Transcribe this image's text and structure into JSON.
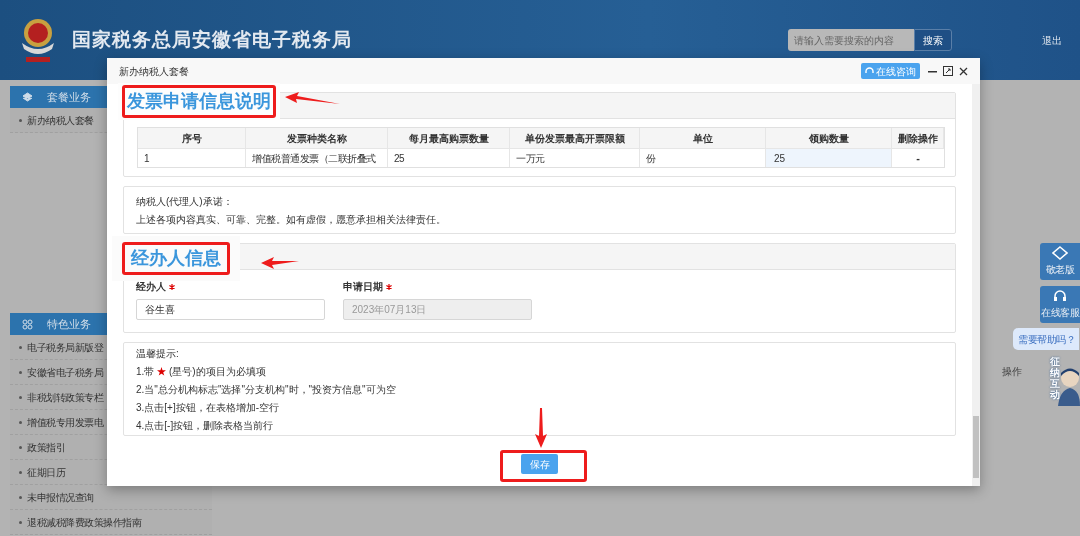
{
  "header": {
    "title": "国家税务总局安徽省电子税务局",
    "search": {
      "placeholder": "请输入需要搜索的内容",
      "button": "搜索"
    },
    "logout": "退出"
  },
  "sidebar": [
    {
      "title": "套餐业务",
      "items": [
        "新办纳税人套餐"
      ]
    },
    {
      "title": "特色业务",
      "items": [
        "电子税务局新版登",
        "安徽省电子税务局",
        "非税划转政策专栏",
        "增值税专用发票电",
        "政策指引",
        "征期日历",
        "未申报情况查询",
        "退税减税降费政策操作指南"
      ]
    }
  ],
  "background_column": "操作",
  "float_buttons": [
    "敬老版",
    "在线客服"
  ],
  "help_bubble": "需要帮助吗？",
  "mascot_label": "征纳互动",
  "dialog": {
    "title": "新办纳税人套餐",
    "consult_button": "在线咨询",
    "invoice_heading": "发票申请信息说明",
    "table": {
      "columns": [
        "序号",
        "发票种类名称",
        "每月最高购票数量",
        "单份发票最高开票限额",
        "单位",
        "领购数量",
        "删除操作"
      ],
      "rows": [
        {
          "cells": [
            "1",
            "增值税普通发票（二联折叠式",
            "25",
            "一万元",
            "份"
          ],
          "quantity": "25",
          "delete": "-"
        }
      ]
    },
    "pledge": [
      "纳税人(代理人)承诺：",
      "上述各项内容真实、可靠、完整。如有虚假，愿意承担相关法律责任。"
    ],
    "agent_heading": "经办人信息",
    "fields": [
      {
        "label": "经办人",
        "required": true,
        "value": "谷生喜",
        "disabled": false
      },
      {
        "label": "申请日期",
        "required": true,
        "value": "2023年07月13日",
        "disabled": true
      }
    ],
    "tips_title": "温馨提示:",
    "tips": [
      "1.带 **★** (星号)的项目为必填项",
      "2.当\"总分机构标志\"选择\"分支机构\"时，\"投资方信息\"可为空",
      "3.点击[+]按钮，在表格增加-空行",
      "4.点击[-]按钮，删除表格当前行"
    ],
    "save_button": "保存"
  }
}
